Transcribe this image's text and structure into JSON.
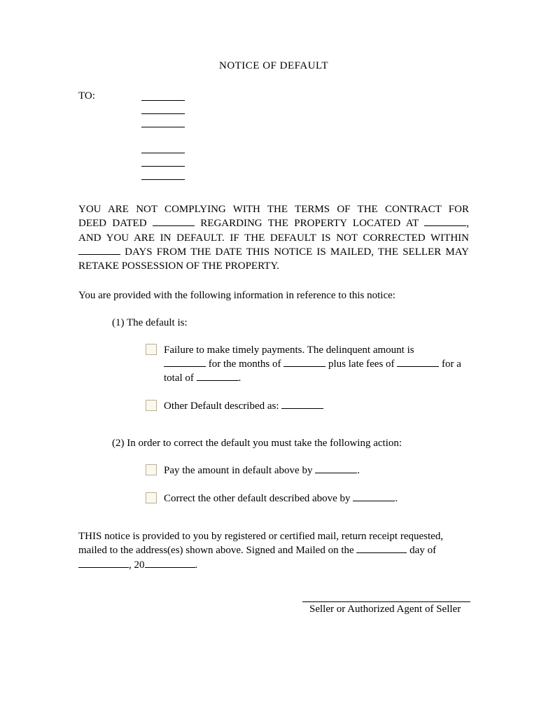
{
  "title": "NOTICE OF DEFAULT",
  "to_label": "TO:",
  "main_para_1": "YOU ARE NOT COMPLYING WITH THE TERMS OF THE CONTRACT FOR",
  "main_para_2a": "DEED DATED ",
  "main_para_2b": " REGARDING THE PROPERTY LOCATED AT ",
  "main_para_2c": ",",
  "main_para_3": "AND YOU ARE IN DEFAULT.  IF THE DEFAULT IS NOT CORRECTED WITHIN ",
  "main_para_4": " DAYS FROM THE DATE THIS NOTICE IS MAILED, THE SELLER MAY RETAKE POSSESSION OF THE PROPERTY.",
  "info_line": "You are provided with the following information in reference to this notice:",
  "item1_label": "(1)",
  "item1_text": "The default is:",
  "item1a_text1": "Failure to make timely payments.  The delinquent amount is ",
  "item1a_text2": "  for the months of ",
  "item1a_text3": " plus late fees of ",
  "item1a_text4": " for a total of ",
  "item1a_text5": ".",
  "item1b_text1": "Other Default described as: ",
  "item2_label": "(2)",
  "item2_text": "In order to correct the default you must take the following action:",
  "item2a_text1": "Pay the amount in default above by ",
  "item2a_text2": ".",
  "item2b_text1": "Correct the other default described above by ",
  "item2b_text2": ".",
  "closing_1": "THIS notice is provided to you by registered or certified mail, return receipt requested, mailed to the address(es) shown above.  Signed and Mailed on the ",
  "closing_2": " day of ",
  "closing_3": ", 20",
  "closing_4": ".",
  "signature_label": "Seller or Authorized Agent of Seller"
}
